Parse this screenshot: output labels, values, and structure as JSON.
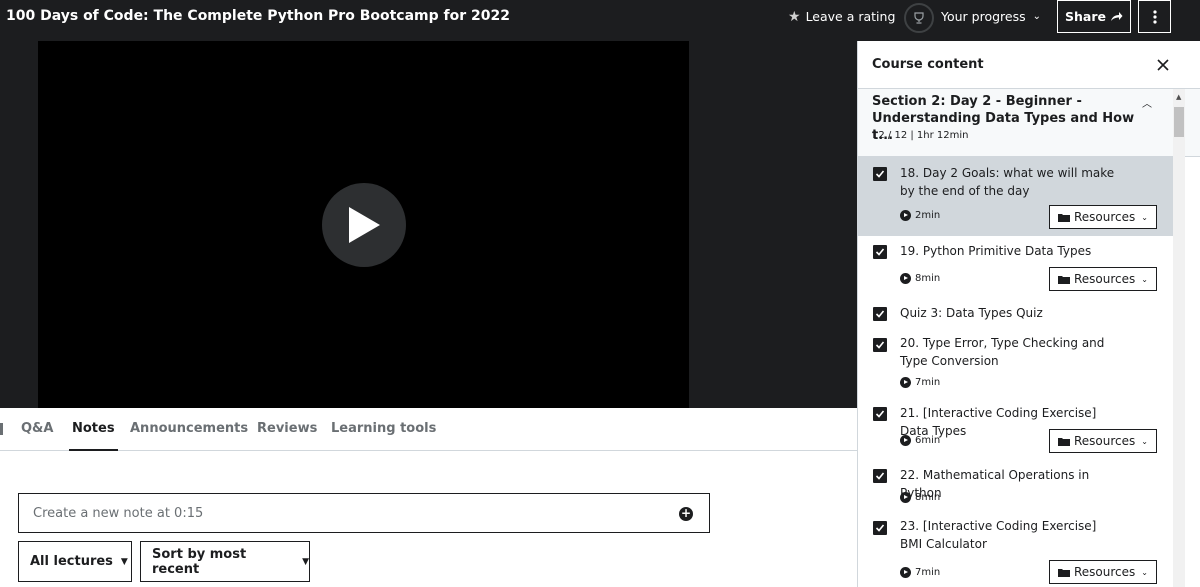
{
  "header": {
    "course_title": "100 Days of Code: The Complete Python Pro Bootcamp for 2022",
    "leave_rating": "Leave a rating",
    "your_progress": "Your progress",
    "share": "Share"
  },
  "tabs": [
    {
      "label": "Q&A"
    },
    {
      "label": "Notes"
    },
    {
      "label": "Announcements"
    },
    {
      "label": "Reviews"
    },
    {
      "label": "Learning tools"
    }
  ],
  "notes": {
    "create_placeholder": "Create a new note at 0:15",
    "filter_lectures": "All lectures",
    "sort": "Sort by most recent"
  },
  "sidebar": {
    "title": "Course content",
    "section": {
      "title": "Section 2: Day 2 - Beginner - Understanding Data Types and How t...",
      "meta": "12 / 12 | 1hr 12min"
    },
    "resources_label": "Resources",
    "items": [
      {
        "title": "18. Day 2 Goals: what we will make by the end of the day",
        "duration": "2min",
        "resources": true,
        "completed": true,
        "current": true
      },
      {
        "title": "19. Python Primitive Data Types",
        "duration": "8min",
        "resources": true,
        "completed": true
      },
      {
        "title": "Quiz 3: Data Types Quiz",
        "duration": "",
        "resources": false,
        "completed": true
      },
      {
        "title": "20. Type Error, Type Checking and Type Conversion",
        "duration": "7min",
        "resources": false,
        "completed": true
      },
      {
        "title": "21. [Interactive Coding Exercise] Data Types",
        "duration": "6min",
        "resources": true,
        "completed": true
      },
      {
        "title": "22. Mathematical Operations in Python",
        "duration": "8min",
        "resources": false,
        "completed": true
      },
      {
        "title": "23. [Interactive Coding Exercise] BMI Calculator",
        "duration": "7min",
        "resources": true,
        "completed": true
      }
    ]
  },
  "colors": {
    "header_bg": "#1c1d1f",
    "current_item_bg": "#d1d7dc",
    "text": "#1c1d1f",
    "muted": "#6a6f73"
  }
}
